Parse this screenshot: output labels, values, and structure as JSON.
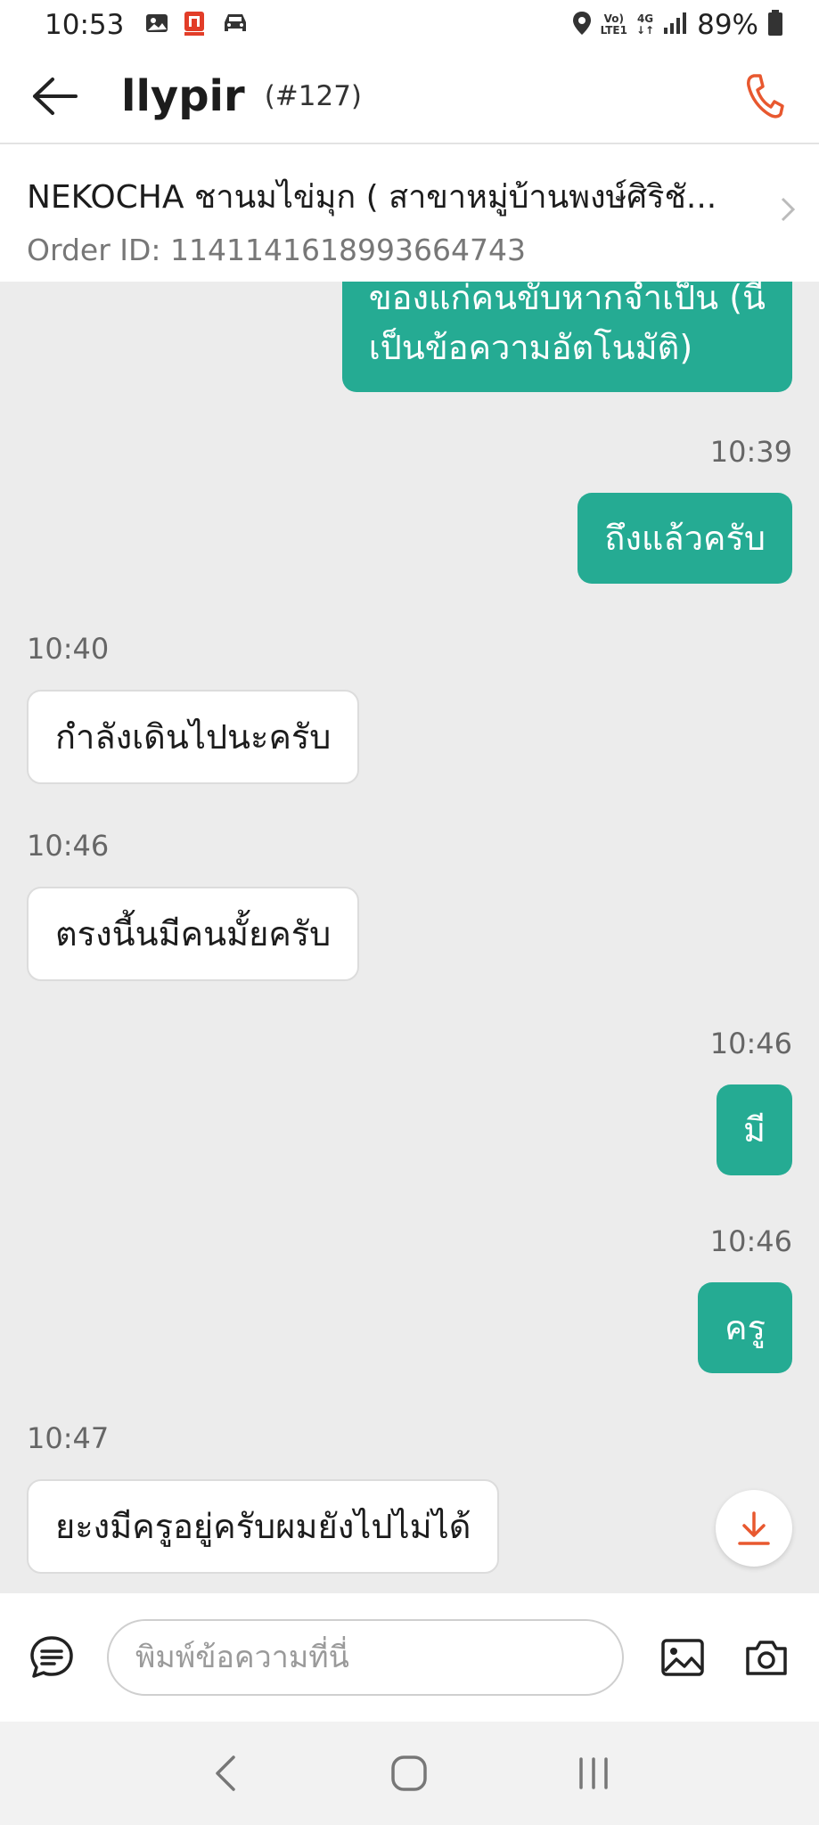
{
  "status_bar": {
    "time": "10:53",
    "network_top": "Vo)",
    "network_bottom": "LTE1",
    "network_type": "4G",
    "battery": "89%",
    "icons": [
      "gallery-icon",
      "app-notification-icon",
      "car-icon",
      "location-icon",
      "signal-icon",
      "battery-icon"
    ]
  },
  "header": {
    "title": "llypir",
    "order_number": "(#127)"
  },
  "merchant": {
    "name": "NEKOCHA ชานมไข่มุก ( สาขาหมู่บ้านพงษ์ศิริชั...",
    "order_id": "Order ID: 1141141618993664743"
  },
  "chat": {
    "messages": [
      {
        "direction": "out",
        "lines": [
          "ของแก่คนขับหากจำเป็น (นี่",
          "เป็นข้อความอัตโนมัติ)"
        ]
      },
      {
        "direction": "out",
        "time": "10:39",
        "text": "ถึงแล้วครับ"
      },
      {
        "direction": "in",
        "time": "10:40",
        "text": "กำลังเดินไปนะครับ"
      },
      {
        "direction": "in",
        "time": "10:46",
        "text": "ตรงนี้นมีคนมั้ยครับ"
      },
      {
        "direction": "out",
        "time": "10:46",
        "text": "มี"
      },
      {
        "direction": "out",
        "time": "10:46",
        "text": "ครู"
      },
      {
        "direction": "in",
        "time": "10:47",
        "text": "ยะงมีครูอยู่ครับผมยังไปไม่ได้"
      }
    ]
  },
  "composer": {
    "placeholder": "พิมพ์ข้อความที่นี่"
  },
  "colors": {
    "accent_green": "#25ab93",
    "call_orange": "#e8582f",
    "background": "#ececec"
  }
}
